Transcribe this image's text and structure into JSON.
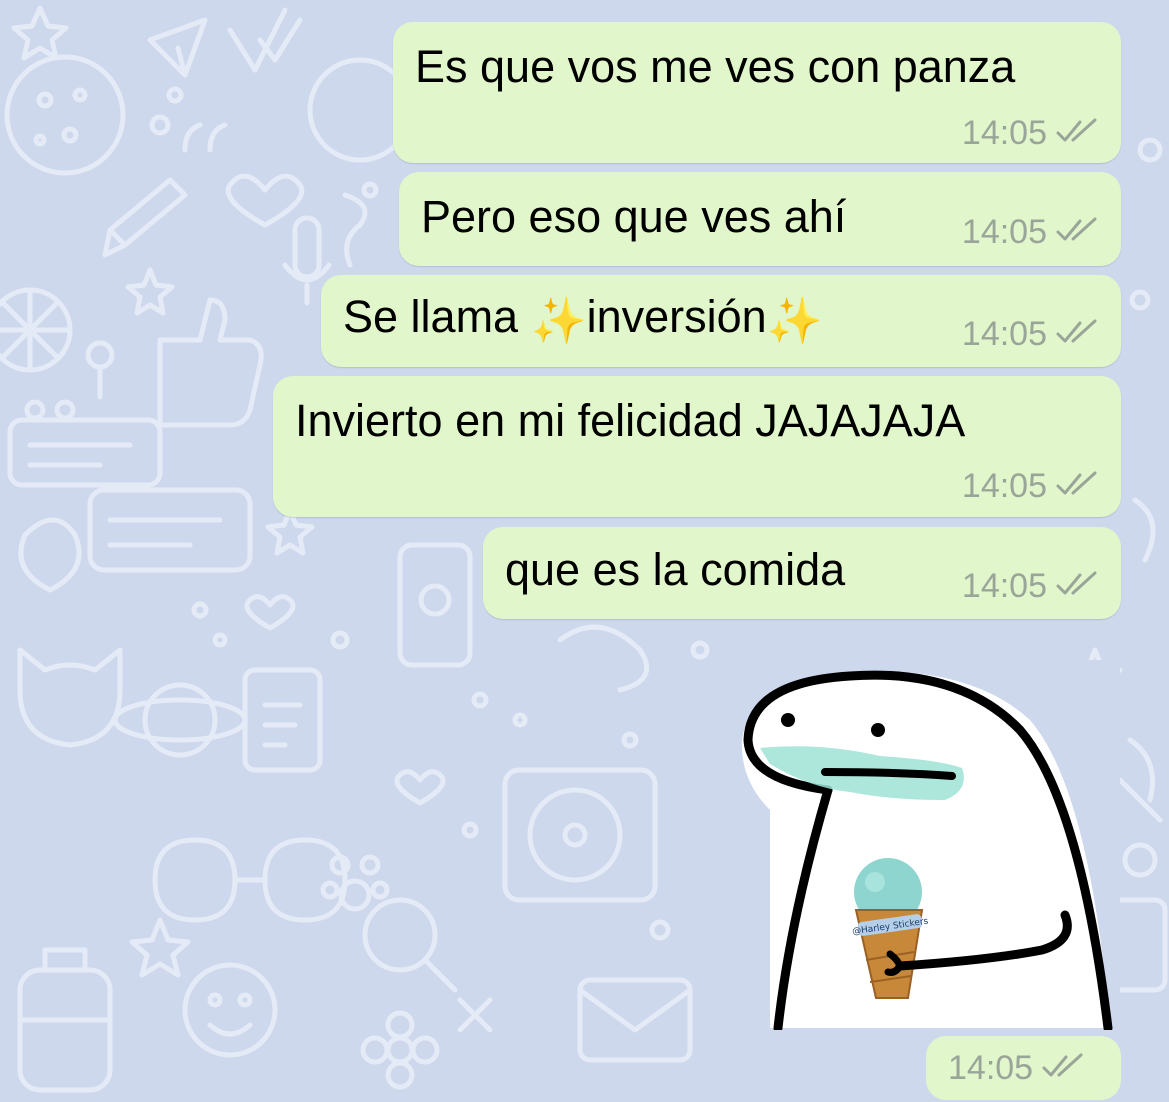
{
  "colors": {
    "background": "#cdd8ec",
    "wallpaper_doodle": "#e4ebf7",
    "outgoing_bubble": "#e1f7cb",
    "timestamp": "#9aa59a",
    "read_ticks": "#9aa59a",
    "text": "#000000"
  },
  "messages": [
    {
      "text": "Es que vos me ves con panza",
      "time": "14:05",
      "status": "read-double-check-icon"
    },
    {
      "text": "Pero eso que ves ahí",
      "time": "14:05",
      "status": "read-double-check-icon"
    },
    {
      "text_before": "Se llama ",
      "emoji": "✨",
      "text_middle": "inversión",
      "time": "14:05",
      "status": "read-double-check-icon"
    },
    {
      "text": "Invierto en mi felicidad JAJAJAJA",
      "time": "14:05",
      "status": "read-double-check-icon"
    },
    {
      "text": "que es la comida",
      "time": "14:05",
      "status": "read-double-check-icon"
    }
  ],
  "sticker": {
    "watermark": "@Harley Stickers",
    "time": "14:05",
    "status": "read-double-check-icon"
  }
}
